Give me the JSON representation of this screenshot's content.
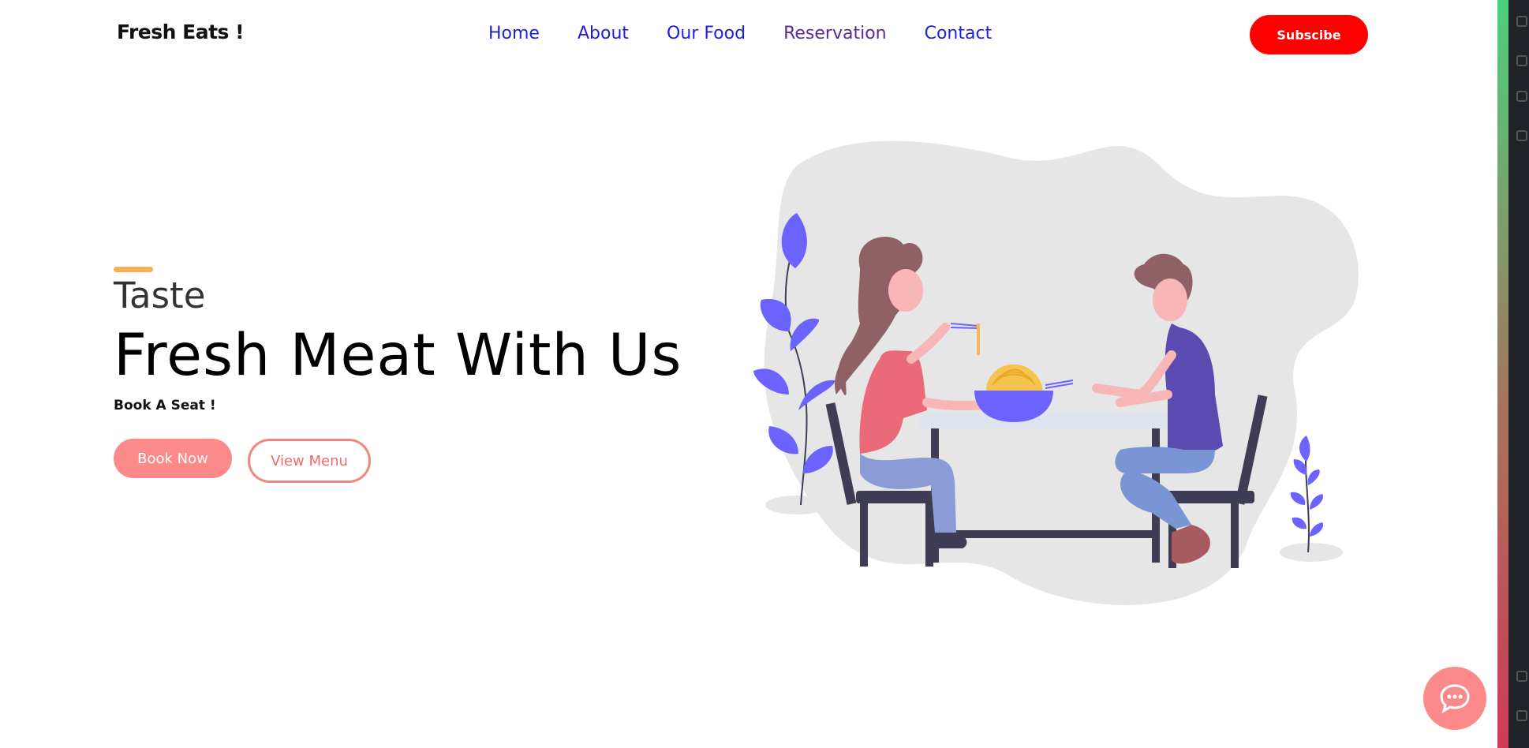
{
  "brand": "Fresh Eats !",
  "nav": {
    "items": [
      {
        "label": "Home"
      },
      {
        "label": "About"
      },
      {
        "label": "Our Food"
      },
      {
        "label": "Reservation"
      },
      {
        "label": "Contact"
      }
    ],
    "subscribe_label": "Subscibe"
  },
  "hero": {
    "subtitle": "Taste",
    "title": "Fresh Meat With Us",
    "note": "Book A Seat !",
    "book_label": "Book Now",
    "menu_label": "View Menu"
  },
  "colors": {
    "accent": "#f4b05b",
    "primary_pink": "#fc8a8a",
    "subscribe_red": "#ff0000",
    "link_blue": "#1f1fd6",
    "link_visited": "#5b2a9a"
  },
  "icons": {
    "chat": "chat-bubble-icon"
  }
}
